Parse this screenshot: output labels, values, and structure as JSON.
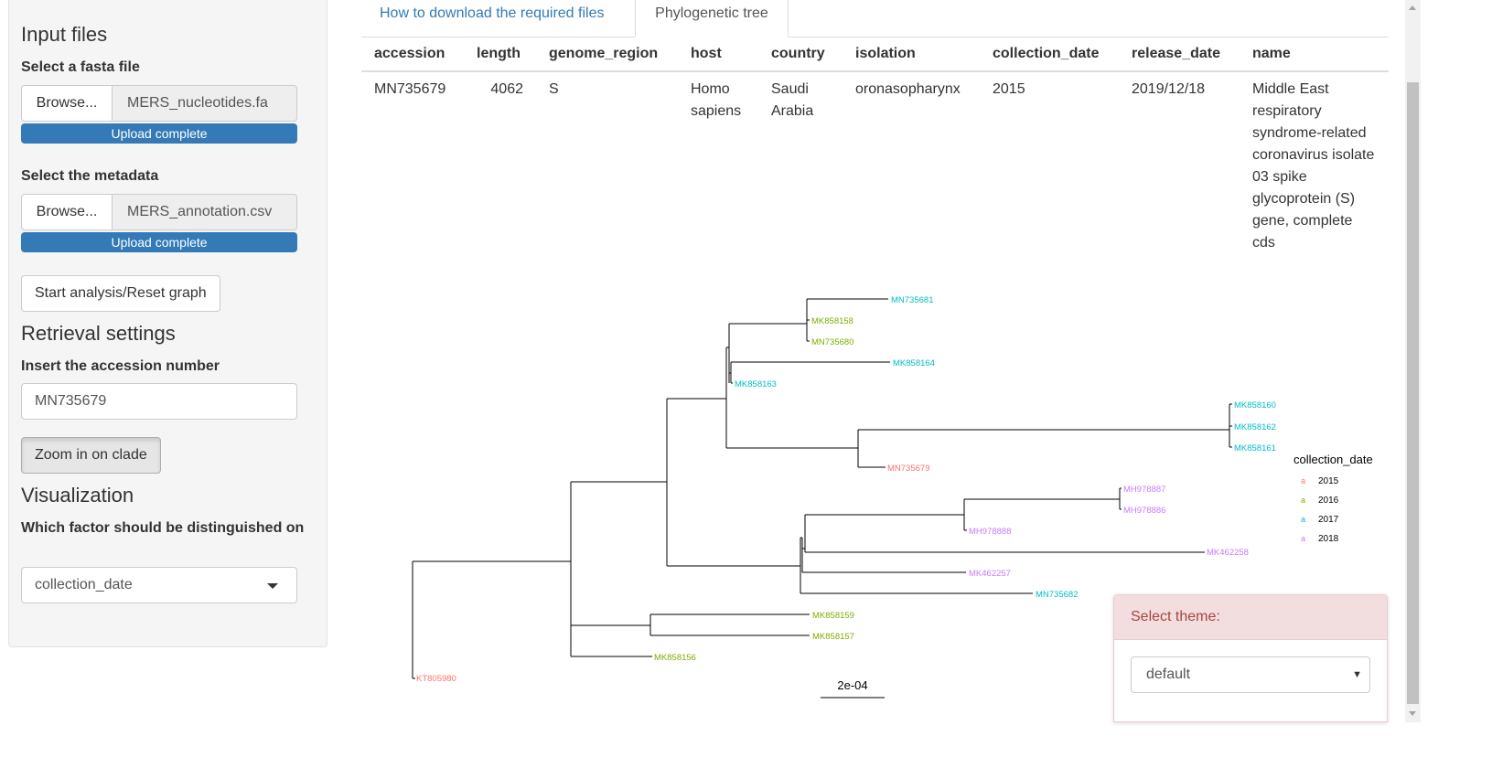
{
  "sidebar": {
    "input_files_heading": "Input files",
    "fasta_label": "Select a fasta file",
    "fasta_browse": "Browse...",
    "fasta_filename": "MERS_nucleotides.fa",
    "fasta_status": "Upload complete",
    "fasta_progress": 1.0,
    "metadata_label": "Select the metadata",
    "metadata_browse": "Browse...",
    "metadata_filename": "MERS_annotation.csv",
    "metadata_status": "Upload complete",
    "metadata_progress": 1.0,
    "start_button": "Start analysis/Reset graph",
    "retrieval_heading": "Retrieval settings",
    "accession_label": "Insert the accession number",
    "accession_value": "MN735679",
    "zoom_button": "Zoom in on clade",
    "visualization_heading": "Visualization",
    "factor_label": "Which factor should be distinguished on",
    "factor_value": "collection_date"
  },
  "tabs": [
    {
      "label": "How to download the required files",
      "active": false
    },
    {
      "label": "Phylogenetic tree",
      "active": true
    }
  ],
  "table": {
    "columns": [
      "accession",
      "length",
      "genome_region",
      "host",
      "country",
      "isolation",
      "collection_date",
      "release_date",
      "name"
    ],
    "row": [
      "MN735679",
      "4062",
      "S",
      "Homo sapiens",
      "Saudi Arabia",
      "oronasopharynx",
      "2015",
      "2019/12/18",
      "Middle East respiratory syndrome-related coronavirus isolate 03 spike glycoprotein (S) gene, complete cds"
    ]
  },
  "tree": {
    "legend_title": "collection_date",
    "legend": [
      {
        "glyph": "a",
        "label": "2015",
        "color": "#f8766d"
      },
      {
        "glyph": "a",
        "label": "2016",
        "color": "#7cae00"
      },
      {
        "glyph": "a",
        "label": "2017",
        "color": "#00bfc4"
      },
      {
        "glyph": "a",
        "label": "2018",
        "color": "#c77cff"
      }
    ],
    "scale_label": "2e-04",
    "tips": [
      {
        "label": "MN735681",
        "year": "2017"
      },
      {
        "label": "MK858158",
        "year": "2016"
      },
      {
        "label": "MN735680",
        "year": "2016"
      },
      {
        "label": "MK858164",
        "year": "2017"
      },
      {
        "label": "MK858163",
        "year": "2017"
      },
      {
        "label": "MK858160",
        "year": "2017"
      },
      {
        "label": "MK858162",
        "year": "2017"
      },
      {
        "label": "MK858161",
        "year": "2017"
      },
      {
        "label": "MN735679",
        "year": "2015"
      },
      {
        "label": "MH978887",
        "year": "2018"
      },
      {
        "label": "MH978886",
        "year": "2018"
      },
      {
        "label": "MH978888",
        "year": "2018"
      },
      {
        "label": "MK462258",
        "year": "2018"
      },
      {
        "label": "MK462257",
        "year": "2018"
      },
      {
        "label": "MN735682",
        "year": "2017"
      },
      {
        "label": "MK858159",
        "year": "2016"
      },
      {
        "label": "MK858157",
        "year": "2016"
      },
      {
        "label": "MK858156",
        "year": "2016"
      },
      {
        "label": "KT805980",
        "year": "2015"
      }
    ]
  },
  "theme_panel": {
    "heading": "Select theme:",
    "value": "default"
  }
}
